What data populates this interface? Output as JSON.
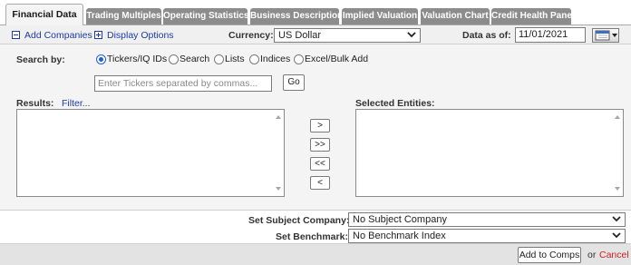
{
  "tabs": [
    {
      "label": "Financial Data",
      "active": true
    },
    {
      "label": "Trading Multiples",
      "active": false
    },
    {
      "label": "Operating Statistics",
      "active": false
    },
    {
      "label": "Business Description",
      "active": false
    },
    {
      "label": "Implied Valuation",
      "active": false
    },
    {
      "label": "Valuation Chart",
      "active": false
    },
    {
      "label": "Credit Health Panel",
      "active": false
    }
  ],
  "toolbar": {
    "add_companies": "Add Companies",
    "display_options": "Display Options",
    "currency_label": "Currency:",
    "currency_value": "US Dollar",
    "data_as_of_label": "Data as of:",
    "data_as_of_value": "11/01/2021"
  },
  "search": {
    "label": "Search by:",
    "options": [
      "Tickers/IQ IDs",
      "Search",
      "Lists",
      "Indices",
      "Excel/Bulk Add"
    ],
    "selected": "Tickers/IQ IDs",
    "placeholder": "Enter Tickers separated by commas...",
    "go_label": "Go"
  },
  "results": {
    "label": "Results:",
    "filter_link": "Filter..."
  },
  "transfer_buttons": [
    ">",
    ">>",
    "<<",
    "<"
  ],
  "selected_entities_label": "Selected Entities:",
  "subject": {
    "label": "Set Subject Company:",
    "value": "No Subject Company"
  },
  "benchmark": {
    "label": "Set Benchmark:",
    "value": "No Benchmark Index"
  },
  "footer": {
    "add_button": "Add to Comps",
    "or_text": "or",
    "cancel_link": "Cancel"
  },
  "colors": {
    "link": "#1c3aa9",
    "cancel": "#d21f1f",
    "tab_inactive": "#8c8c8c",
    "radio_selected": "#1f5fd8"
  }
}
